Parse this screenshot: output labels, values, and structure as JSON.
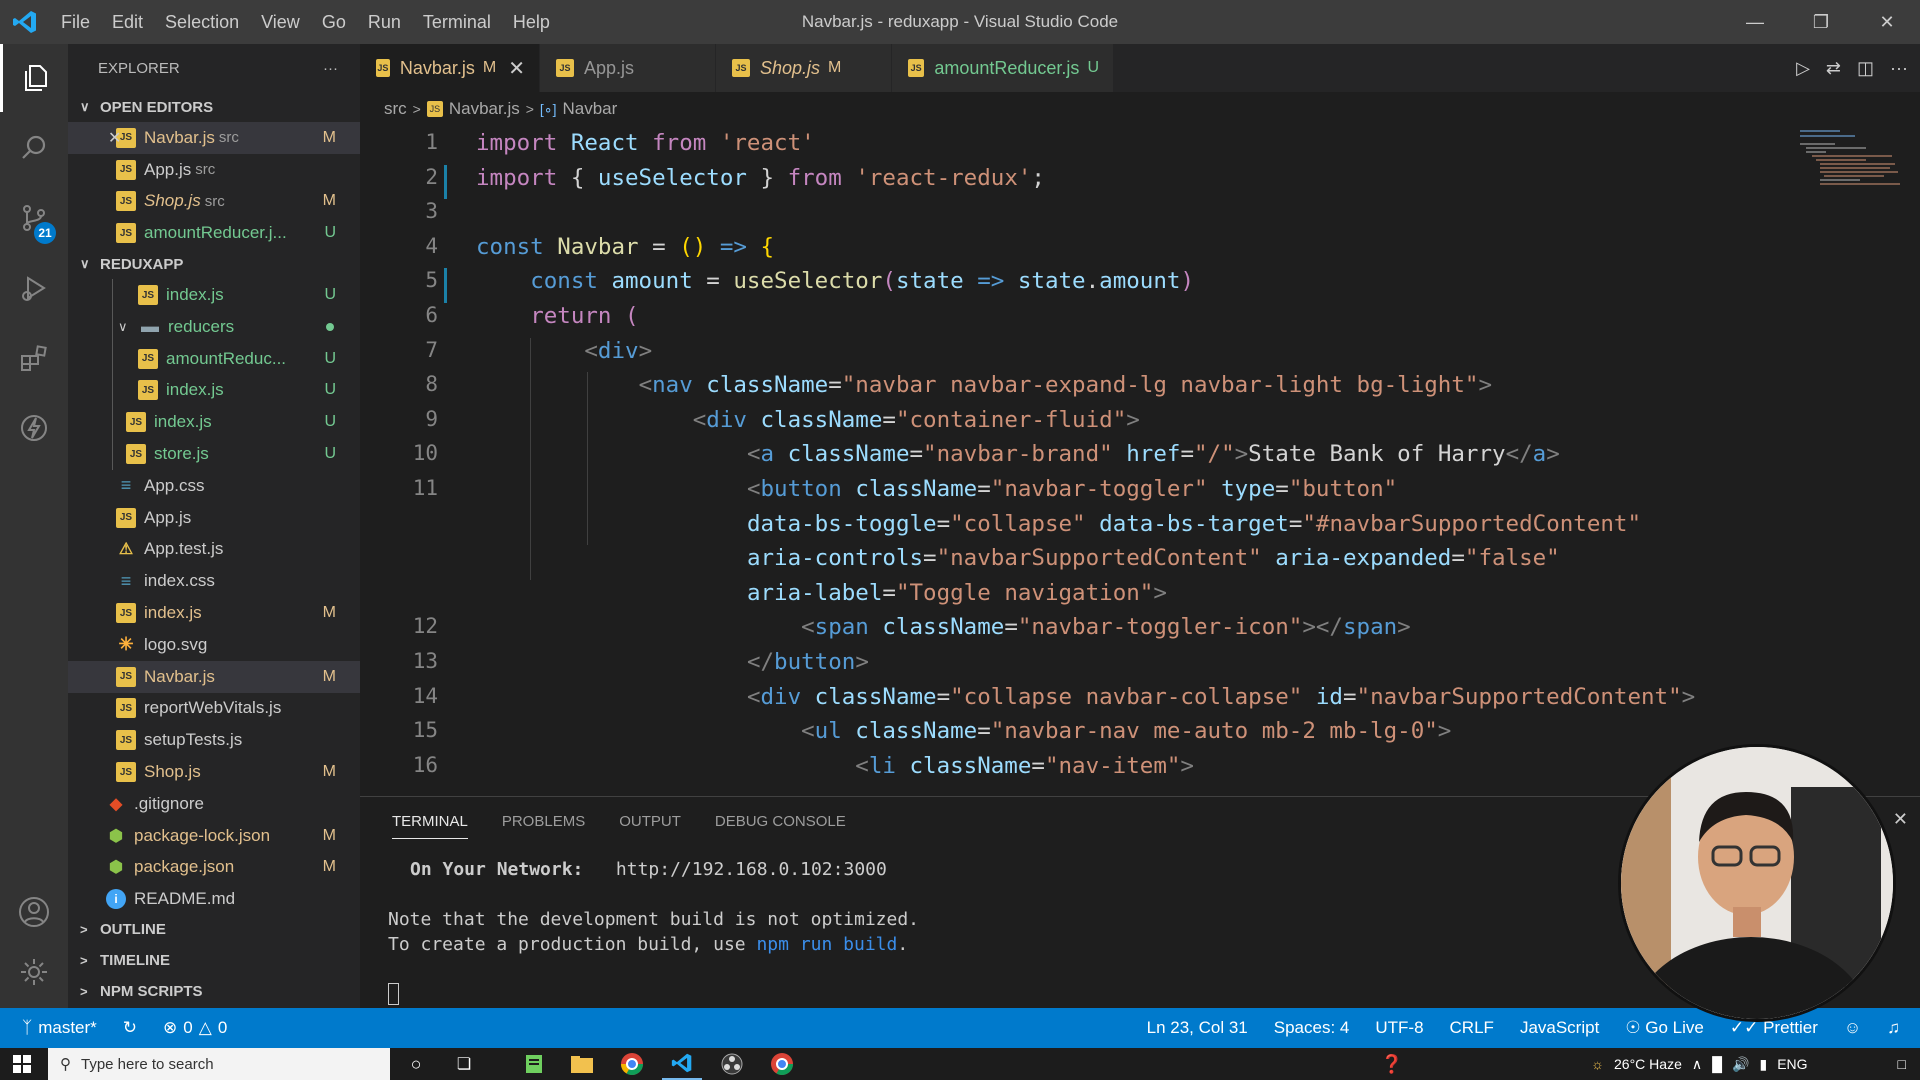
{
  "window": {
    "title": "Navbar.js - reduxapp - Visual Studio Code",
    "menu": [
      "File",
      "Edit",
      "Selection",
      "View",
      "Go",
      "Run",
      "Terminal",
      "Help"
    ]
  },
  "activity": {
    "scm_badge": "21"
  },
  "explorer": {
    "header": "EXPLORER",
    "more": "···",
    "open_editors_label": "OPEN EDITORS",
    "open_editors": [
      {
        "name": "Navbar.js",
        "desc": "src",
        "status": "M",
        "italic": false,
        "close": true
      },
      {
        "name": "App.js",
        "desc": "src",
        "status": "",
        "italic": false,
        "close": false
      },
      {
        "name": "Shop.js",
        "desc": "src",
        "status": "M",
        "italic": true,
        "close": false
      },
      {
        "name": "amountReducer.j...",
        "desc": "",
        "status": "U",
        "italic": false,
        "close": false
      }
    ],
    "project_label": "REDUXAPP",
    "tree": [
      {
        "name": "index.js",
        "icon": "js",
        "status": "U",
        "depth": 3
      },
      {
        "name": "reducers",
        "icon": "folder",
        "status": "dot",
        "depth": 2
      },
      {
        "name": "amountReduc...",
        "icon": "js",
        "status": "U",
        "depth": 3
      },
      {
        "name": "index.js",
        "icon": "js",
        "status": "U",
        "depth": 3
      },
      {
        "name": "index.js",
        "icon": "js",
        "status": "U",
        "depth": 2
      },
      {
        "name": "store.js",
        "icon": "js",
        "status": "U",
        "depth": 2
      },
      {
        "name": "App.css",
        "icon": "css",
        "status": "",
        "depth": 1
      },
      {
        "name": "App.js",
        "icon": "js",
        "status": "",
        "depth": 1
      },
      {
        "name": "App.test.js",
        "icon": "test",
        "status": "",
        "depth": 1
      },
      {
        "name": "index.css",
        "icon": "css",
        "status": "",
        "depth": 1
      },
      {
        "name": "index.js",
        "icon": "js",
        "status": "M",
        "depth": 1
      },
      {
        "name": "logo.svg",
        "icon": "svg",
        "status": "",
        "depth": 1
      },
      {
        "name": "Navbar.js",
        "icon": "js",
        "status": "M",
        "depth": 1,
        "selected": true
      },
      {
        "name": "reportWebVitals.js",
        "icon": "js",
        "status": "",
        "depth": 1
      },
      {
        "name": "setupTests.js",
        "icon": "js",
        "status": "",
        "depth": 1
      },
      {
        "name": "Shop.js",
        "icon": "js",
        "status": "M",
        "depth": 1
      },
      {
        "name": ".gitignore",
        "icon": "git",
        "status": "",
        "depth": 0
      },
      {
        "name": "package-lock.json",
        "icon": "npm",
        "status": "M",
        "depth": 0
      },
      {
        "name": "package.json",
        "icon": "npm",
        "status": "M",
        "depth": 0
      },
      {
        "name": "README.md",
        "icon": "info",
        "status": "",
        "depth": 0
      }
    ],
    "bottom_sections": [
      "OUTLINE",
      "TIMELINE",
      "NPM SCRIPTS"
    ]
  },
  "tabs": [
    {
      "name": "Navbar.js",
      "status": "M",
      "active": true,
      "italic": false
    },
    {
      "name": "App.js",
      "status": "",
      "active": false,
      "italic": false
    },
    {
      "name": "Shop.js",
      "status": "M",
      "active": false,
      "italic": true
    },
    {
      "name": "amountReducer.js",
      "status": "U",
      "active": false,
      "italic": false
    }
  ],
  "breadcrumb": {
    "folder": "src",
    "file": "Navbar.js",
    "symbol": "Navbar"
  },
  "editor": {
    "lines": [
      {
        "n": "1",
        "t": [
          [
            "kw2",
            "import "
          ],
          [
            "var",
            "React "
          ],
          [
            "kw2",
            "from "
          ],
          [
            "str",
            "'react'"
          ]
        ]
      },
      {
        "n": "2",
        "t": [
          [
            "kw2",
            "import "
          ],
          [
            "punc",
            "{ "
          ],
          [
            "var",
            "useSelector "
          ],
          [
            "punc",
            "} "
          ],
          [
            "kw2",
            "from "
          ],
          [
            "str",
            "'react-redux'"
          ],
          [
            "punc",
            ";"
          ]
        ]
      },
      {
        "n": "3",
        "t": []
      },
      {
        "n": "4",
        "t": [
          [
            "kw",
            "const "
          ],
          [
            "fn",
            "Navbar "
          ],
          [
            "punc",
            "= "
          ],
          [
            "yel",
            "() "
          ],
          [
            "kw",
            "=> "
          ],
          [
            "yel",
            "{"
          ]
        ]
      },
      {
        "n": "5",
        "t": [
          [
            "punc",
            "    "
          ],
          [
            "kw",
            "const "
          ],
          [
            "var",
            "amount "
          ],
          [
            "punc",
            "= "
          ],
          [
            "fn",
            "useSelector"
          ],
          [
            "kw2",
            "("
          ],
          [
            "var",
            "state "
          ],
          [
            "kw",
            "=> "
          ],
          [
            "var",
            "state"
          ],
          [
            "punc",
            "."
          ],
          [
            "var",
            "amount"
          ],
          [
            "kw2",
            ")"
          ]
        ]
      },
      {
        "n": "6",
        "t": [
          [
            "punc",
            "    "
          ],
          [
            "kw2",
            "return "
          ],
          [
            "kw2",
            "("
          ]
        ]
      },
      {
        "n": "7",
        "t": [
          [
            "punc",
            "        "
          ],
          [
            "brk",
            "<"
          ],
          [
            "tag",
            "div"
          ],
          [
            "brk",
            ">"
          ]
        ]
      },
      {
        "n": "8",
        "t": [
          [
            "punc",
            "            "
          ],
          [
            "brk",
            "<"
          ],
          [
            "tag",
            "nav "
          ],
          [
            "attr",
            "className"
          ],
          [
            "punc",
            "="
          ],
          [
            "str",
            "\"navbar navbar-expand-lg navbar-light bg-light\""
          ],
          [
            "brk",
            ">"
          ]
        ]
      },
      {
        "n": "9",
        "t": [
          [
            "punc",
            "                "
          ],
          [
            "brk",
            "<"
          ],
          [
            "tag",
            "div "
          ],
          [
            "attr",
            "className"
          ],
          [
            "punc",
            "="
          ],
          [
            "str",
            "\"container-fluid\""
          ],
          [
            "brk",
            ">"
          ]
        ]
      },
      {
        "n": "10",
        "t": [
          [
            "punc",
            "                    "
          ],
          [
            "brk",
            "<"
          ],
          [
            "tag",
            "a "
          ],
          [
            "attr",
            "className"
          ],
          [
            "punc",
            "="
          ],
          [
            "str",
            "\"navbar-brand\" "
          ],
          [
            "attr",
            "href"
          ],
          [
            "punc",
            "="
          ],
          [
            "str",
            "\"/\""
          ],
          [
            "brk",
            ">"
          ],
          [
            "txt",
            "State Bank of Harry"
          ],
          [
            "brk",
            "</"
          ],
          [
            "tag",
            "a"
          ],
          [
            "brk",
            ">"
          ]
        ]
      },
      {
        "n": "11",
        "t": [
          [
            "punc",
            "                    "
          ],
          [
            "brk",
            "<"
          ],
          [
            "tag",
            "button "
          ],
          [
            "attr",
            "className"
          ],
          [
            "punc",
            "="
          ],
          [
            "str",
            "\"navbar-toggler\" "
          ],
          [
            "attr",
            "type"
          ],
          [
            "punc",
            "="
          ],
          [
            "str",
            "\"button\""
          ]
        ]
      },
      {
        "n": "",
        "t": [
          [
            "punc",
            "                    "
          ],
          [
            "attr",
            "data-bs-toggle"
          ],
          [
            "punc",
            "="
          ],
          [
            "str",
            "\"collapse\" "
          ],
          [
            "attr",
            "data-bs-target"
          ],
          [
            "punc",
            "="
          ],
          [
            "str",
            "\"#navbarSupportedContent\""
          ]
        ]
      },
      {
        "n": "",
        "t": [
          [
            "punc",
            "                    "
          ],
          [
            "attr",
            "aria-controls"
          ],
          [
            "punc",
            "="
          ],
          [
            "str",
            "\"navbarSupportedContent\" "
          ],
          [
            "attr",
            "aria-expanded"
          ],
          [
            "punc",
            "="
          ],
          [
            "str",
            "\"false\""
          ]
        ]
      },
      {
        "n": "",
        "t": [
          [
            "punc",
            "                    "
          ],
          [
            "attr",
            "aria-label"
          ],
          [
            "punc",
            "="
          ],
          [
            "str",
            "\"Toggle navigation\""
          ],
          [
            "brk",
            ">"
          ]
        ]
      },
      {
        "n": "12",
        "t": [
          [
            "punc",
            "                        "
          ],
          [
            "brk",
            "<"
          ],
          [
            "tag",
            "span "
          ],
          [
            "attr",
            "className"
          ],
          [
            "punc",
            "="
          ],
          [
            "str",
            "\"navbar-toggler-icon\""
          ],
          [
            "brk",
            "></"
          ],
          [
            "tag",
            "span"
          ],
          [
            "brk",
            ">"
          ]
        ]
      },
      {
        "n": "13",
        "t": [
          [
            "punc",
            "                    "
          ],
          [
            "brk",
            "</"
          ],
          [
            "tag",
            "button"
          ],
          [
            "brk",
            ">"
          ]
        ]
      },
      {
        "n": "14",
        "t": [
          [
            "punc",
            "                    "
          ],
          [
            "brk",
            "<"
          ],
          [
            "tag",
            "div "
          ],
          [
            "attr",
            "className"
          ],
          [
            "punc",
            "="
          ],
          [
            "str",
            "\"collapse navbar-collapse\" "
          ],
          [
            "attr",
            "id"
          ],
          [
            "punc",
            "="
          ],
          [
            "str",
            "\"navbarSupportedContent\""
          ],
          [
            "brk",
            ">"
          ]
        ]
      },
      {
        "n": "15",
        "t": [
          [
            "punc",
            "                        "
          ],
          [
            "brk",
            "<"
          ],
          [
            "tag",
            "ul "
          ],
          [
            "attr",
            "className"
          ],
          [
            "punc",
            "="
          ],
          [
            "str",
            "\"navbar-nav me-auto mb-2 mb-lg-0\""
          ],
          [
            "brk",
            ">"
          ]
        ]
      },
      {
        "n": "16",
        "t": [
          [
            "punc",
            "                            "
          ],
          [
            "brk",
            "<"
          ],
          [
            "tag",
            "li "
          ],
          [
            "attr",
            "className"
          ],
          [
            "punc",
            "="
          ],
          [
            "str",
            "\"nav-item\""
          ],
          [
            "brk",
            ">"
          ]
        ]
      }
    ]
  },
  "panel": {
    "tabs": [
      "TERMINAL",
      "PROBLEMS",
      "OUTPUT",
      "DEBUG CONSOLE"
    ],
    "network_label": "On Your Network:",
    "network_url": "http://192.168.0.102:3000",
    "note1": "Note that the development build is not optimized.",
    "note2_pre": "To create a production build, use ",
    "note2_cmd": "npm run build",
    "note2_post": "."
  },
  "status": {
    "branch": "master*",
    "errors": "0",
    "warnings": "0",
    "position": "Ln 23, Col 31",
    "spaces": "Spaces: 4",
    "encoding": "UTF-8",
    "eol": "CRLF",
    "language": "JavaScript",
    "golive": "Go Live",
    "prettier": "Prettier"
  },
  "taskbar": {
    "search_placeholder": "Type here to search",
    "weather": "26°C  Haze",
    "lang": "ENG"
  },
  "colors": {
    "accent": "#007acc",
    "modified": "#e2c08d",
    "untracked": "#73c991",
    "js_icon": "#e8c04a"
  }
}
